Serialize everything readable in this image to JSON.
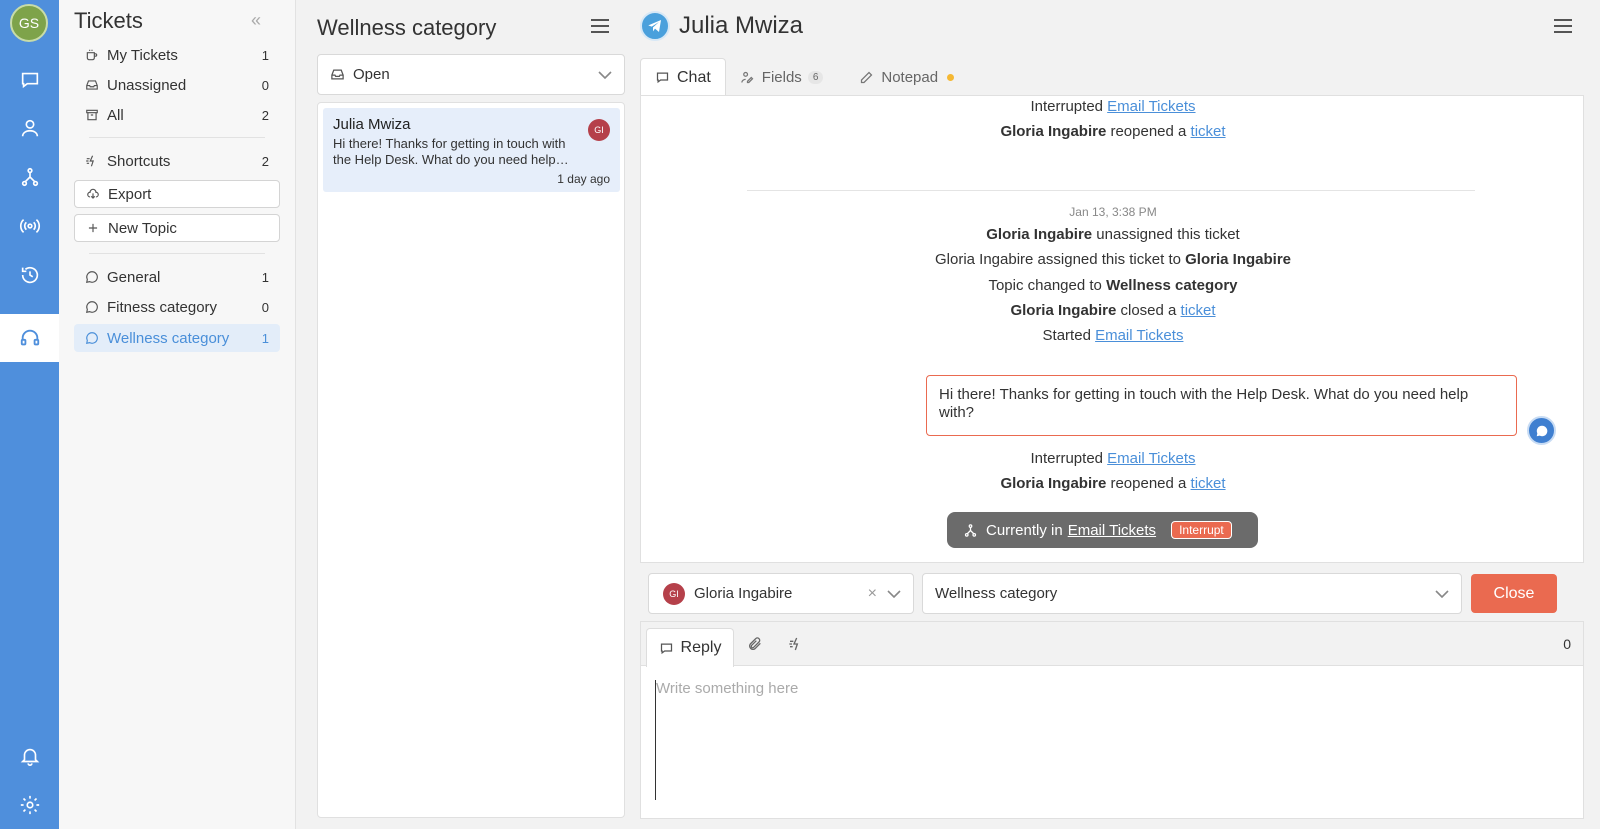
{
  "user": {
    "initials": "GS"
  },
  "sidebar": {
    "title": "Tickets",
    "items": [
      {
        "label": "My Tickets",
        "count": "1"
      },
      {
        "label": "Unassigned",
        "count": "0"
      },
      {
        "label": "All",
        "count": "2"
      },
      {
        "label": "Shortcuts",
        "count": "2"
      }
    ],
    "export_label": "Export",
    "new_topic_label": "New Topic",
    "topics": [
      {
        "label": "General",
        "count": "1"
      },
      {
        "label": "Fitness category",
        "count": "0"
      },
      {
        "label": "Wellness category",
        "count": "1"
      }
    ]
  },
  "list": {
    "title": "Wellness category",
    "status": "Open",
    "tickets": [
      {
        "name": "Julia Mwiza",
        "preview": "Hi there! Thanks for getting in touch with the Help Desk. What do you need help…",
        "time": "1 day ago",
        "agent_initials": "GI"
      }
    ]
  },
  "conversation": {
    "contact_name": "Julia Mwiza",
    "tabs": {
      "chat": "Chat",
      "fields": "Fields",
      "fields_count": "6",
      "notepad": "Notepad"
    },
    "events_top": {
      "interrupted": "Interrupted",
      "flow": "Email Tickets",
      "agent": "Gloria Ingabire",
      "reopened": "reopened a",
      "ticket": "ticket"
    },
    "date": "Jan 13, 3:38 PM",
    "events": {
      "agent": "Gloria Ingabire",
      "unassigned": "unassigned this ticket",
      "assigned": "assigned this ticket to",
      "topic_changed": "Topic changed to",
      "topic": "Wellness category",
      "closed": "closed a",
      "ticket": "ticket",
      "started": "Started",
      "flow": "Email Tickets"
    },
    "message": "Hi there! Thanks for getting in touch with the Help Desk. What do you need help with?",
    "events_bottom": {
      "interrupted": "Interrupted",
      "flow": "Email Tickets",
      "agent": "Gloria Ingabire",
      "reopened": "reopened a",
      "ticket": "ticket"
    },
    "current": {
      "label": "Currently in",
      "flow": "Email Tickets",
      "interrupt": "Interrupt"
    },
    "assignee": {
      "name": "Gloria Ingabire",
      "initials": "GI"
    },
    "topic": "Wellness category",
    "close_label": "Close",
    "reply": {
      "tab": "Reply",
      "count": "0",
      "placeholder": "Write something here"
    }
  },
  "colors": {
    "rail": "#4f8fdc",
    "accent": "#4a8fd9",
    "danger": "#ea6a50"
  }
}
